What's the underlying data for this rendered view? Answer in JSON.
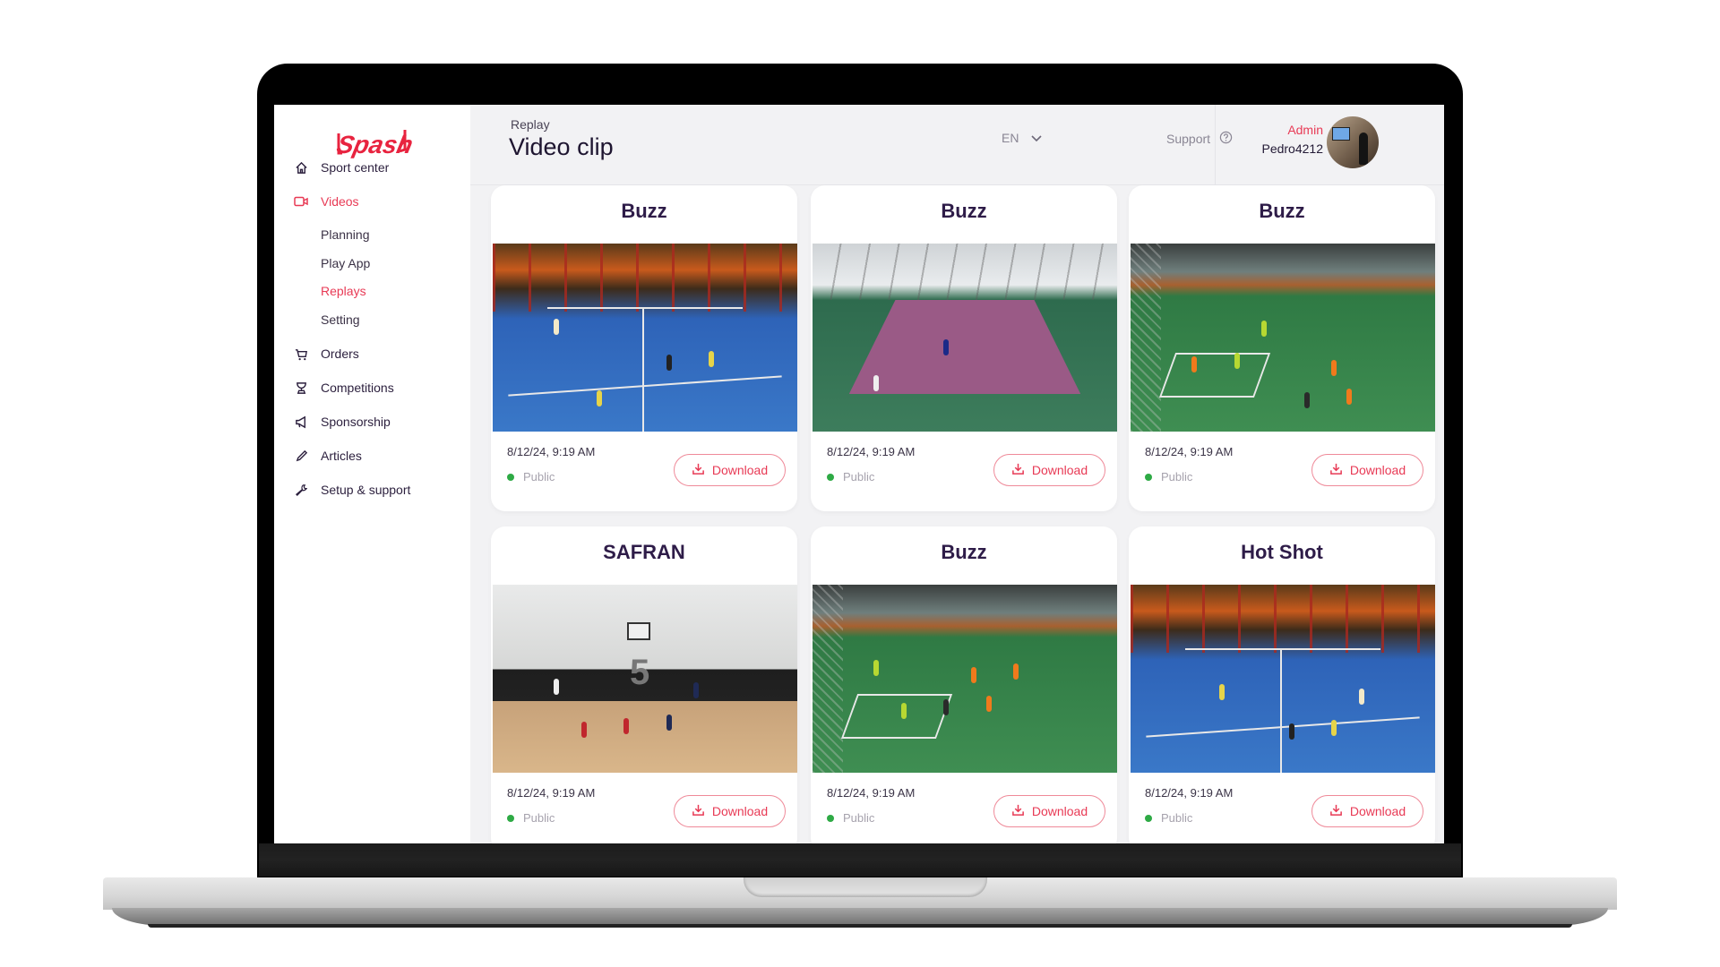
{
  "app": {
    "logo_text": "Spash",
    "brand_color": "#e83a55"
  },
  "sidebar": {
    "items": [
      {
        "label": "Sport center",
        "icon": "home-icon",
        "active": false
      },
      {
        "label": "Videos",
        "icon": "video-camera-icon",
        "active": true
      },
      {
        "label": "Orders",
        "icon": "cart-icon",
        "active": false
      },
      {
        "label": "Competitions",
        "icon": "trophy-icon",
        "active": false
      },
      {
        "label": "Sponsorship",
        "icon": "megaphone-icon",
        "active": false
      },
      {
        "label": "Articles",
        "icon": "pencil-icon",
        "active": false
      },
      {
        "label": "Setup & support",
        "icon": "wrench-icon",
        "active": false
      }
    ],
    "video_subitems": [
      {
        "label": "Planning",
        "active": false
      },
      {
        "label": "Play App",
        "active": false
      },
      {
        "label": "Replays",
        "active": true
      },
      {
        "label": "Setting",
        "active": false
      }
    ]
  },
  "header": {
    "breadcrumb": "Replay",
    "title": "Video clip",
    "language": "EN",
    "support_label": "Support",
    "user": {
      "role": "Admin",
      "username": "Pedro4212"
    }
  },
  "clips": [
    {
      "title": "Buzz",
      "scene": "padel",
      "date": "8/12/24, 9:19 AM",
      "visibility": "Public",
      "download_label": "Download"
    },
    {
      "title": "Buzz",
      "scene": "tennis",
      "date": "8/12/24, 9:19 AM",
      "visibility": "Public",
      "download_label": "Download"
    },
    {
      "title": "Buzz",
      "scene": "soccer",
      "date": "8/12/24, 9:19 AM",
      "visibility": "Public",
      "download_label": "Download"
    },
    {
      "title": "SAFRAN",
      "scene": "basketball",
      "date": "8/12/24, 9:19 AM",
      "visibility": "Public",
      "download_label": "Download"
    },
    {
      "title": "Buzz",
      "scene": "soccer",
      "date": "8/12/24, 9:19 AM",
      "visibility": "Public",
      "download_label": "Download"
    },
    {
      "title": "Hot Shot",
      "scene": "padel",
      "date": "8/12/24, 9:19 AM",
      "visibility": "Public",
      "download_label": "Download"
    }
  ],
  "basketball_court_number": "5"
}
